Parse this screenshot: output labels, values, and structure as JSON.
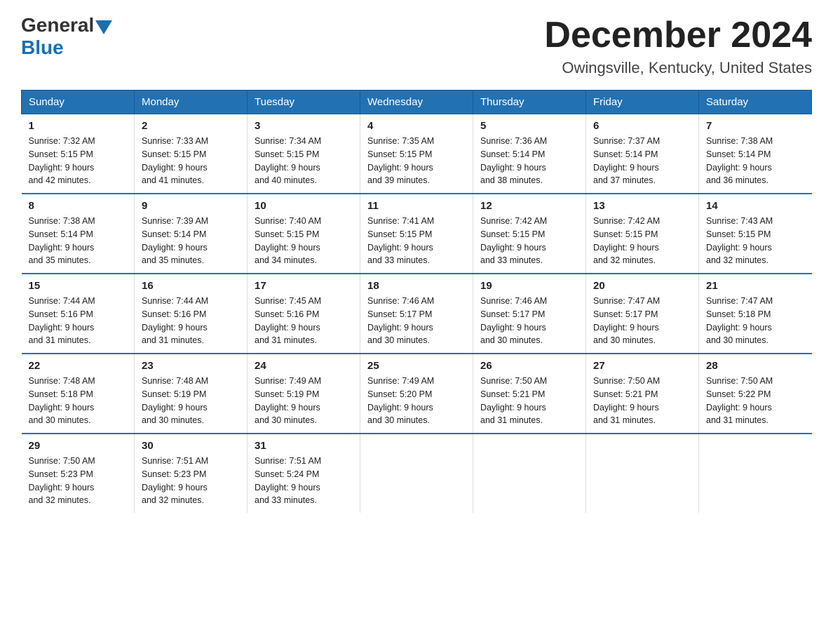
{
  "header": {
    "logo_general": "General",
    "logo_blue": "Blue",
    "title": "December 2024",
    "subtitle": "Owingsville, Kentucky, United States"
  },
  "weekdays": [
    "Sunday",
    "Monday",
    "Tuesday",
    "Wednesday",
    "Thursday",
    "Friday",
    "Saturday"
  ],
  "weeks": [
    [
      {
        "day": "1",
        "sunrise": "7:32 AM",
        "sunset": "5:15 PM",
        "daylight": "9 hours and 42 minutes."
      },
      {
        "day": "2",
        "sunrise": "7:33 AM",
        "sunset": "5:15 PM",
        "daylight": "9 hours and 41 minutes."
      },
      {
        "day": "3",
        "sunrise": "7:34 AM",
        "sunset": "5:15 PM",
        "daylight": "9 hours and 40 minutes."
      },
      {
        "day": "4",
        "sunrise": "7:35 AM",
        "sunset": "5:15 PM",
        "daylight": "9 hours and 39 minutes."
      },
      {
        "day": "5",
        "sunrise": "7:36 AM",
        "sunset": "5:14 PM",
        "daylight": "9 hours and 38 minutes."
      },
      {
        "day": "6",
        "sunrise": "7:37 AM",
        "sunset": "5:14 PM",
        "daylight": "9 hours and 37 minutes."
      },
      {
        "day": "7",
        "sunrise": "7:38 AM",
        "sunset": "5:14 PM",
        "daylight": "9 hours and 36 minutes."
      }
    ],
    [
      {
        "day": "8",
        "sunrise": "7:38 AM",
        "sunset": "5:14 PM",
        "daylight": "9 hours and 35 minutes."
      },
      {
        "day": "9",
        "sunrise": "7:39 AM",
        "sunset": "5:14 PM",
        "daylight": "9 hours and 35 minutes."
      },
      {
        "day": "10",
        "sunrise": "7:40 AM",
        "sunset": "5:15 PM",
        "daylight": "9 hours and 34 minutes."
      },
      {
        "day": "11",
        "sunrise": "7:41 AM",
        "sunset": "5:15 PM",
        "daylight": "9 hours and 33 minutes."
      },
      {
        "day": "12",
        "sunrise": "7:42 AM",
        "sunset": "5:15 PM",
        "daylight": "9 hours and 33 minutes."
      },
      {
        "day": "13",
        "sunrise": "7:42 AM",
        "sunset": "5:15 PM",
        "daylight": "9 hours and 32 minutes."
      },
      {
        "day": "14",
        "sunrise": "7:43 AM",
        "sunset": "5:15 PM",
        "daylight": "9 hours and 32 minutes."
      }
    ],
    [
      {
        "day": "15",
        "sunrise": "7:44 AM",
        "sunset": "5:16 PM",
        "daylight": "9 hours and 31 minutes."
      },
      {
        "day": "16",
        "sunrise": "7:44 AM",
        "sunset": "5:16 PM",
        "daylight": "9 hours and 31 minutes."
      },
      {
        "day": "17",
        "sunrise": "7:45 AM",
        "sunset": "5:16 PM",
        "daylight": "9 hours and 31 minutes."
      },
      {
        "day": "18",
        "sunrise": "7:46 AM",
        "sunset": "5:17 PM",
        "daylight": "9 hours and 30 minutes."
      },
      {
        "day": "19",
        "sunrise": "7:46 AM",
        "sunset": "5:17 PM",
        "daylight": "9 hours and 30 minutes."
      },
      {
        "day": "20",
        "sunrise": "7:47 AM",
        "sunset": "5:17 PM",
        "daylight": "9 hours and 30 minutes."
      },
      {
        "day": "21",
        "sunrise": "7:47 AM",
        "sunset": "5:18 PM",
        "daylight": "9 hours and 30 minutes."
      }
    ],
    [
      {
        "day": "22",
        "sunrise": "7:48 AM",
        "sunset": "5:18 PM",
        "daylight": "9 hours and 30 minutes."
      },
      {
        "day": "23",
        "sunrise": "7:48 AM",
        "sunset": "5:19 PM",
        "daylight": "9 hours and 30 minutes."
      },
      {
        "day": "24",
        "sunrise": "7:49 AM",
        "sunset": "5:19 PM",
        "daylight": "9 hours and 30 minutes."
      },
      {
        "day": "25",
        "sunrise": "7:49 AM",
        "sunset": "5:20 PM",
        "daylight": "9 hours and 30 minutes."
      },
      {
        "day": "26",
        "sunrise": "7:50 AM",
        "sunset": "5:21 PM",
        "daylight": "9 hours and 31 minutes."
      },
      {
        "day": "27",
        "sunrise": "7:50 AM",
        "sunset": "5:21 PM",
        "daylight": "9 hours and 31 minutes."
      },
      {
        "day": "28",
        "sunrise": "7:50 AM",
        "sunset": "5:22 PM",
        "daylight": "9 hours and 31 minutes."
      }
    ],
    [
      {
        "day": "29",
        "sunrise": "7:50 AM",
        "sunset": "5:23 PM",
        "daylight": "9 hours and 32 minutes."
      },
      {
        "day": "30",
        "sunrise": "7:51 AM",
        "sunset": "5:23 PM",
        "daylight": "9 hours and 32 minutes."
      },
      {
        "day": "31",
        "sunrise": "7:51 AM",
        "sunset": "5:24 PM",
        "daylight": "9 hours and 33 minutes."
      },
      null,
      null,
      null,
      null
    ]
  ],
  "labels": {
    "sunrise": "Sunrise:",
    "sunset": "Sunset:",
    "daylight": "Daylight:"
  }
}
